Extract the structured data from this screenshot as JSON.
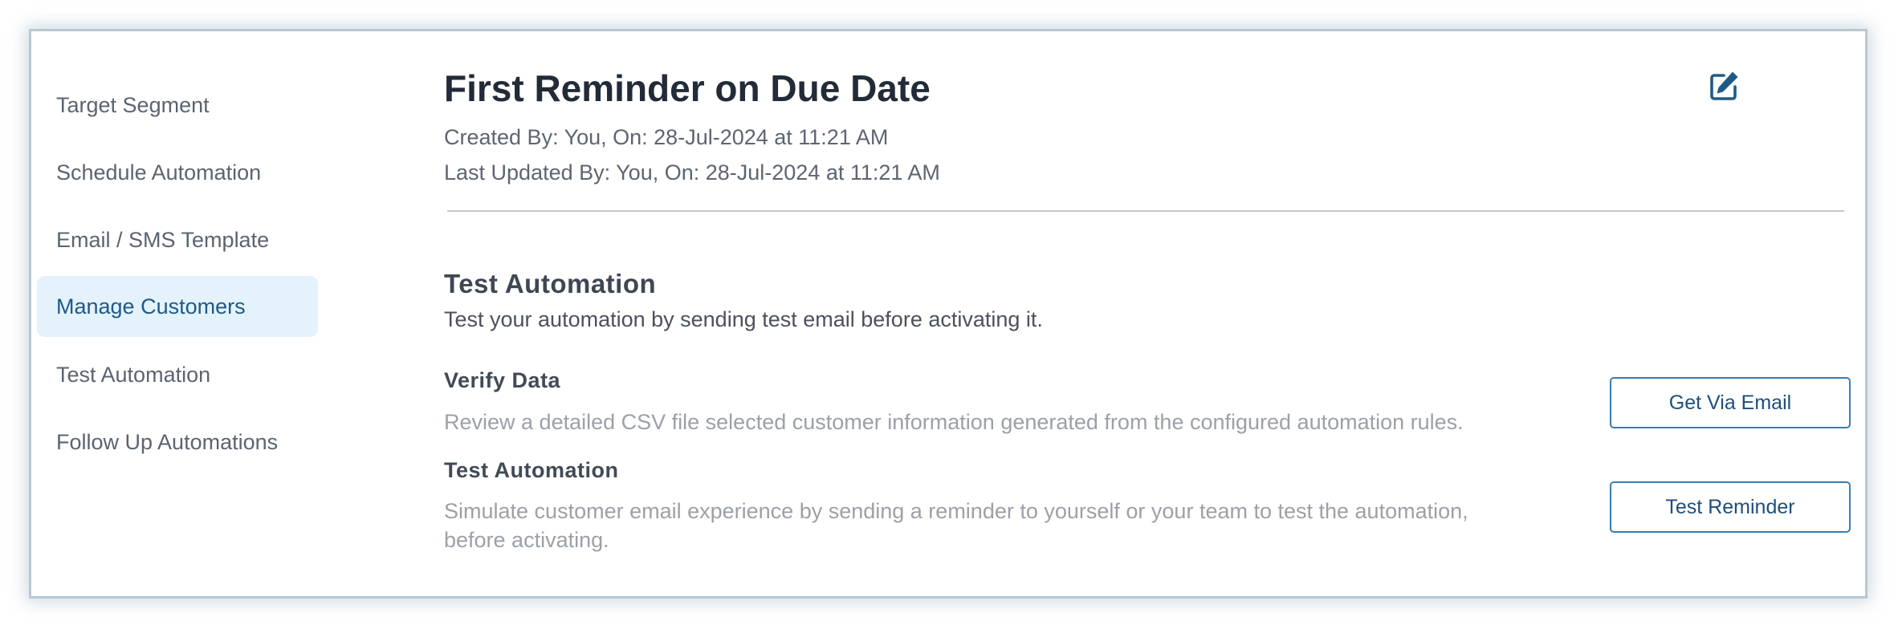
{
  "sidebar": {
    "items": [
      {
        "label": "Target Segment",
        "active": false
      },
      {
        "label": "Schedule Automation",
        "active": false
      },
      {
        "label": "Email / SMS Template",
        "active": false
      },
      {
        "label": "Manage Customers",
        "active": true
      },
      {
        "label": "Test Automation",
        "active": false
      },
      {
        "label": "Follow Up Automations",
        "active": false
      }
    ]
  },
  "header": {
    "title": "First Reminder on Due Date",
    "created": "Created By: You, On: 28-Jul-2024 at 11:21 AM",
    "updated": "Last Updated By: You, On: 28-Jul-2024 at 11:21 AM",
    "edit_icon": "edit-icon"
  },
  "test_section": {
    "title": "Test Automation",
    "description": "Test your automation by sending test email before activating it.",
    "verify": {
      "title": "Verify Data",
      "description": "Review a detailed CSV file selected customer information generated from the configured automation rules.",
      "button": "Get Via Email"
    },
    "test": {
      "title": "Test Automation",
      "description": "Simulate customer email experience by sending a reminder to yourself or your team to test the automation, before activating.",
      "button": "Test Reminder"
    }
  },
  "colors": {
    "accent": "#1f5a86",
    "active_bg": "#e4f2fb",
    "button_border": "#3b7cb2"
  }
}
